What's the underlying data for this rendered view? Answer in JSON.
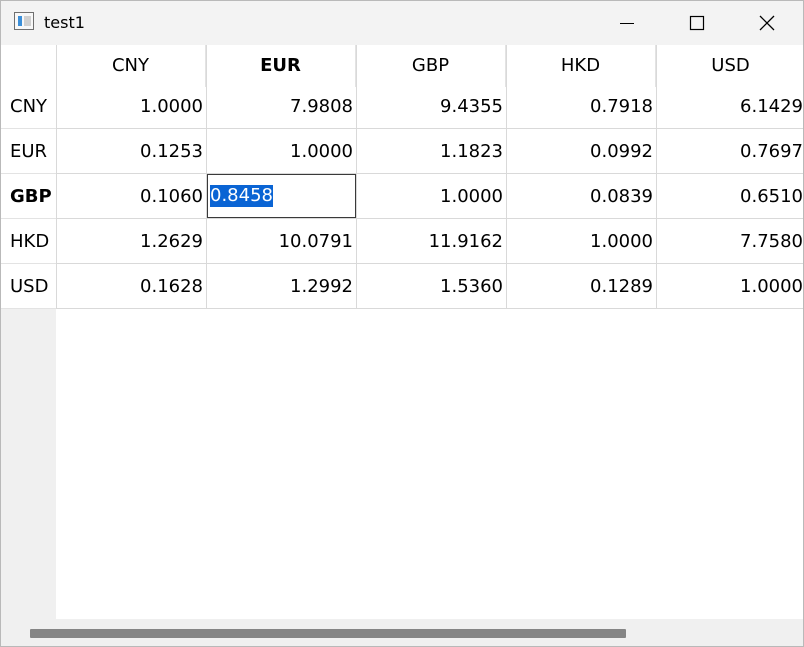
{
  "window": {
    "title": "test1"
  },
  "table": {
    "columns": [
      "CNY",
      "EUR",
      "GBP",
      "HKD",
      "USD"
    ],
    "rows": [
      {
        "label": "CNY",
        "cells": [
          "1.0000",
          "7.9808",
          "9.4355",
          "0.7918",
          "6.1429"
        ]
      },
      {
        "label": "EUR",
        "cells": [
          "0.1253",
          "1.0000",
          "1.1823",
          "0.0992",
          "0.7697"
        ]
      },
      {
        "label": "GBP",
        "cells": [
          "0.1060",
          "0.8458",
          "1.0000",
          "0.0839",
          "0.6510"
        ]
      },
      {
        "label": "HKD",
        "cells": [
          "1.2629",
          "10.0791",
          "11.9162",
          "1.0000",
          "7.7580"
        ]
      },
      {
        "label": "USD",
        "cells": [
          "0.1628",
          "1.2992",
          "1.5360",
          "0.1289",
          "1.0000"
        ]
      }
    ],
    "current_column": "EUR",
    "current_row": "GBP"
  },
  "colors": {
    "selection": "#0a64d4",
    "header_background": "#f0f0f0",
    "scrollbar_thumb": "#858585"
  }
}
